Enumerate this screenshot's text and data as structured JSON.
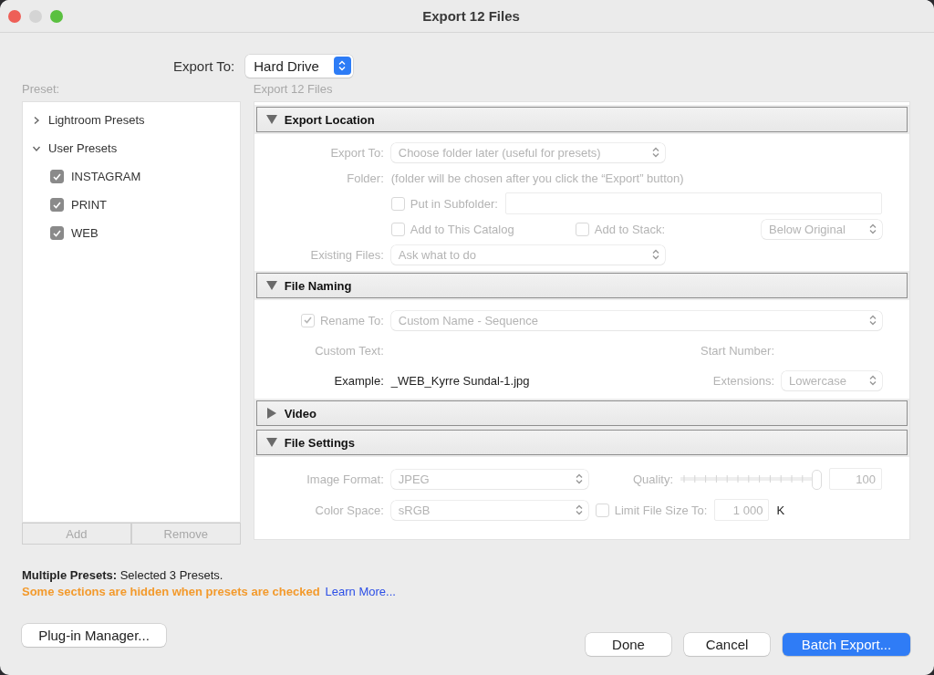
{
  "window": {
    "title": "Export 12 Files"
  },
  "export_to": {
    "label": "Export To:",
    "value": "Hard Drive"
  },
  "preset_panel": {
    "label": "Preset:",
    "tree": [
      {
        "label": "Lightroom Presets",
        "expanded": false
      },
      {
        "label": "User Presets",
        "expanded": true,
        "children": [
          {
            "label": "INSTAGRAM",
            "checked": true
          },
          {
            "label": "PRINT",
            "checked": true
          },
          {
            "label": "WEB",
            "checked": true
          }
        ]
      }
    ],
    "buttons": [
      "Add",
      "Remove"
    ]
  },
  "settings_heading": "Export 12 Files",
  "sections": [
    {
      "title": "Export Location",
      "expanded": true,
      "rows": [
        {
          "kind": "select",
          "label": {
            "kind": "label",
            "text": "Export To:",
            "disabled": true
          },
          "items": [
            {
              "kind": "select",
              "value": "Choose folder later (useful for presets)",
              "disabled": true
            }
          ]
        },
        {
          "kind": "note",
          "label": {
            "kind": "label",
            "text": "Folder:",
            "disabled": true
          },
          "items": [
            {
              "kind": "text",
              "text": "(folder will be chosen after you click the “Export” button)",
              "disabled": true
            }
          ]
        },
        {
          "kind": "subfolder",
          "items": [
            {
              "kind": "checkbox",
              "text": "Put in Subfolder:",
              "checked": false,
              "disabled": true
            },
            {
              "kind": "field",
              "disabled": true
            }
          ]
        },
        {
          "kind": "catalog",
          "items": [
            {
              "kind": "checkbox",
              "text": "Add to This Catalog",
              "checked": false,
              "disabled": true
            },
            {
              "kind": "checkbox",
              "text": "Add to Stack:",
              "checked": false,
              "disabled": true
            },
            {
              "kind": "select",
              "value": "Below Original",
              "disabled": true
            }
          ]
        },
        {
          "kind": "select",
          "label": {
            "kind": "label",
            "text": "Existing Files:",
            "disabled": true
          },
          "items": [
            {
              "kind": "select",
              "value": "Ask what to do",
              "disabled": true
            }
          ]
        }
      ]
    },
    {
      "title": "File Naming",
      "expanded": true,
      "rows": [
        {
          "kind": "rename",
          "label": {
            "kind": "checkbox",
            "text": "Rename To:",
            "checked": true,
            "disabled": true
          },
          "items": [
            {
              "kind": "select",
              "value": "Custom Name - Sequence",
              "disabled": true
            }
          ]
        },
        {
          "kind": "numbering",
          "label": {
            "kind": "label",
            "text": "Custom Text:",
            "disabled": true
          },
          "items": [
            {
              "kind": "label",
              "text": "Start Number:",
              "disabled": true
            }
          ]
        },
        {
          "kind": "example",
          "label": {
            "kind": "label",
            "text": "Example:",
            "disabled": false
          },
          "items": [
            {
              "kind": "text",
              "text": "_WEB_Kyrre Sundal-1.jpg",
              "disabled": false
            },
            {
              "kind": "label",
              "text": "Extensions:",
              "disabled": true
            },
            {
              "kind": "select",
              "value": "Lowercase",
              "disabled": true
            }
          ]
        }
      ]
    },
    {
      "title": "Video",
      "expanded": false
    },
    {
      "title": "File Settings",
      "expanded": true,
      "rows": [
        {
          "kind": "format",
          "label": {
            "kind": "label",
            "text": "Image Format:",
            "disabled": true
          },
          "items": [
            {
              "kind": "select",
              "value": "JPEG",
              "disabled": true
            },
            {
              "kind": "label",
              "text": "Quality:",
              "disabled": true
            },
            {
              "kind": "slider",
              "level": 1,
              "disabled": true
            },
            {
              "kind": "field",
              "value": "100",
              "disabled": true
            }
          ]
        },
        {
          "kind": "limit",
          "label": {
            "kind": "label",
            "text": "Color Space:",
            "disabled": true
          },
          "items": [
            {
              "kind": "select",
              "value": "sRGB",
              "disabled": true
            },
            {
              "kind": "checkbox",
              "text": "Limit File Size To:",
              "checked": false,
              "disabled": true
            },
            {
              "kind": "field",
              "value": "1 000",
              "disabled": true
            },
            {
              "kind": "text",
              "text": "K",
              "disabled": false
            }
          ]
        }
      ]
    }
  ],
  "status": {
    "summary": "**Multiple Presets:** Selected 3 Presets.",
    "warning": "Some sections are hidden when presets are checked",
    "link": "Learn More..."
  },
  "footer_buttons": [
    {
      "label": "Plug-in Manager...",
      "primary": false
    },
    {
      "label": "Done",
      "primary": false
    },
    {
      "label": "Cancel",
      "primary": false
    },
    {
      "label": "Batch Export...",
      "primary": true
    }
  ]
}
